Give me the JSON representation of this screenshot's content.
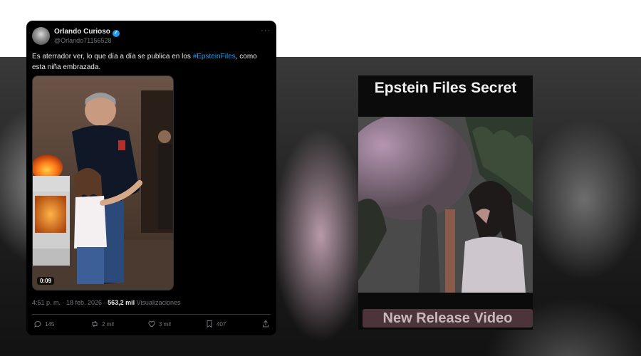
{
  "tweet": {
    "author_name": "Orlando Curioso",
    "author_handle": "@Orlando71156528",
    "text_before": "Es aterrador ver, lo que día a día se publica en los ",
    "hashtag": "#EpsteinFiles",
    "text_after": ", como esta niña embrazada.",
    "video_duration": "0:09",
    "time": "4:51 p. m. · 18 feb. 2026 · ",
    "views_count": "563,2 mil",
    "views_label": " Visualizaciones",
    "replies": "145",
    "reposts": "2 mil",
    "likes": "3 mil",
    "bookmarks": "407"
  },
  "video_panel": {
    "title": "Epstein Files Secret",
    "banner": "New Release Video"
  },
  "colors": {
    "accent_blue": "#1d9bf0",
    "tweet_bg": "#000000",
    "muted_text": "#71767b"
  },
  "icons": [
    "verified-badge-icon",
    "more-options-icon",
    "reply-icon",
    "repost-icon",
    "like-icon",
    "bookmark-icon",
    "share-icon"
  ]
}
